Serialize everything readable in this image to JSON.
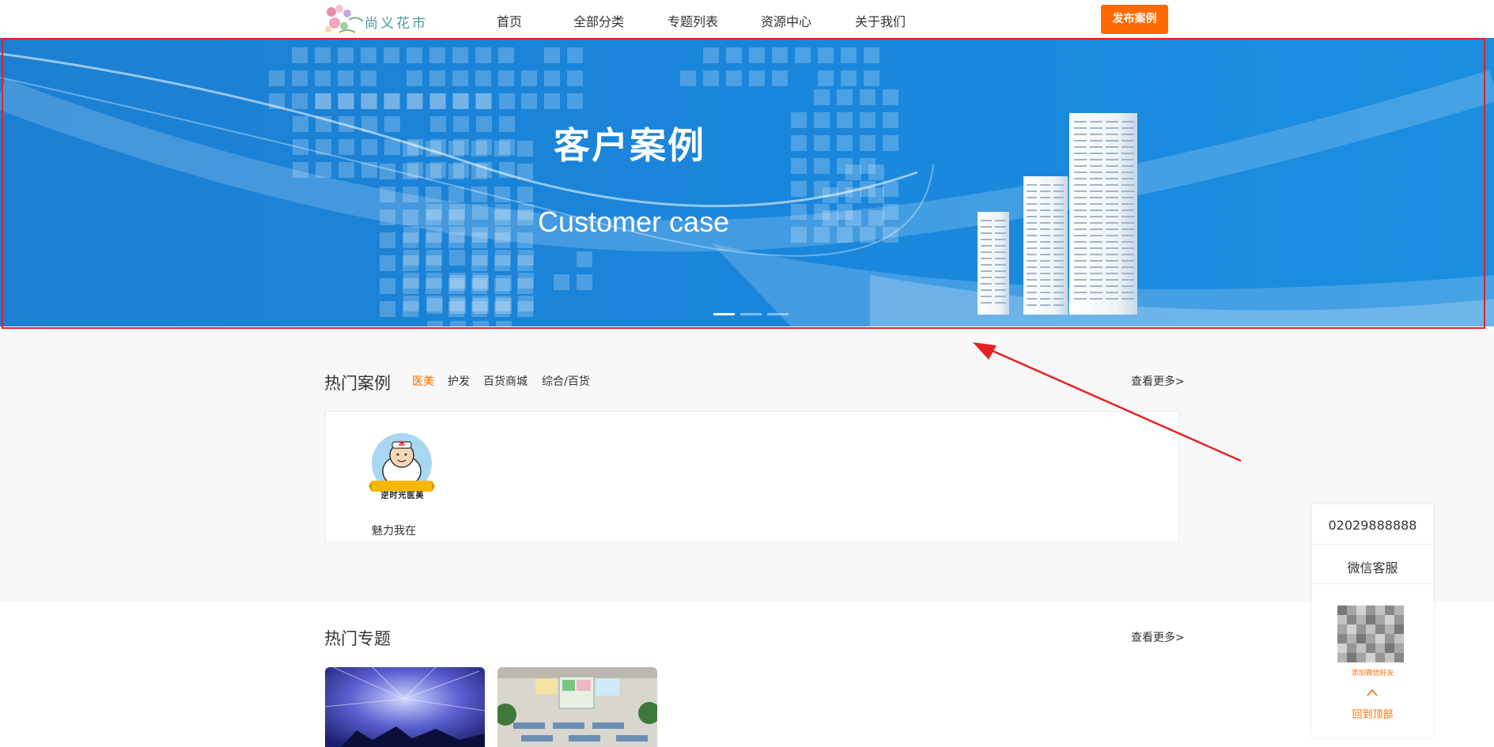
{
  "header": {
    "logo_text": "尚义花市",
    "nav": [
      "首页",
      "全部分类",
      "专题列表",
      "资源中心",
      "关于我们"
    ],
    "publish_label": "发布案例"
  },
  "banner": {
    "title": "客户案例",
    "subtitle": "Customer case",
    "slide_count": 3,
    "active_slide": 1
  },
  "hot_cases": {
    "title": "热门案例",
    "tabs": [
      "医美",
      "护发",
      "百货商城",
      "综合/百货"
    ],
    "active_tab": "医美",
    "more_label": "查看更多>",
    "items": [
      {
        "name": "魅力我在",
        "logo_caption": "逆时光医美"
      }
    ]
  },
  "hot_topics": {
    "title": "热门专题",
    "more_label": "查看更多>"
  },
  "service": {
    "phone": "02029888888",
    "wechat_label": "微信客服",
    "qr_tip": "添加微信好友",
    "back_top_label": "回到顶部"
  },
  "colors": {
    "accent": "#ff6a00",
    "banner_blue": "#1a84d8",
    "annotation_red": "#e52222"
  }
}
